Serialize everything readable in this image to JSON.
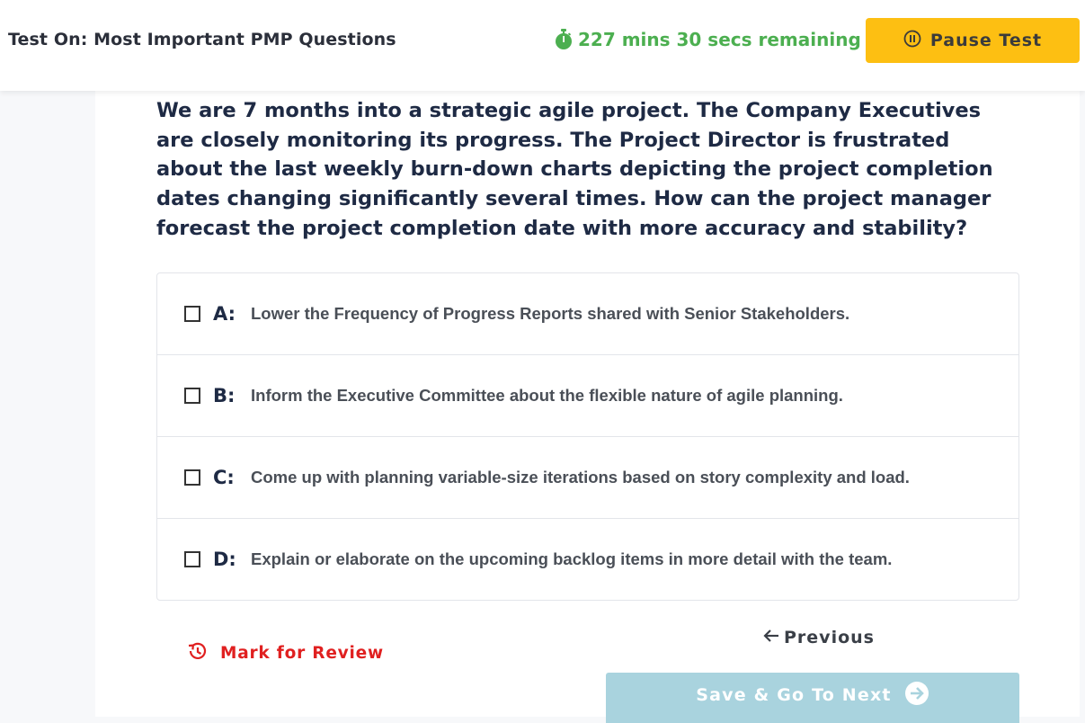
{
  "header": {
    "title": "Test On: Most Important PMP Questions",
    "timer_text": "227 mins 30 secs remaining",
    "timer_icon": "stopwatch-icon",
    "pause_label": "Pause Test",
    "pause_icon": "pause-circle-icon"
  },
  "colors": {
    "timer": "#4caf50",
    "pause_button": "#fdbf12",
    "mark_review": "#e02020",
    "next_button": "#a9d3de",
    "question_text": "#1e2a44"
  },
  "question": {
    "text": "We are 7 months into a strategic agile project. The Company Executives are closely monitoring its progress. The Project Director is frustrated about the last weekly burn-down charts depicting the project completion dates changing significantly several times. How can the project manager forecast the project completion date with more accuracy and stability?"
  },
  "options": [
    {
      "letter": "A:",
      "text": "Lower the Frequency of Progress Reports shared with Senior Stakeholders.",
      "checked": false
    },
    {
      "letter": "B:",
      "text": "Inform the Executive Committee about the flexible nature of agile planning.",
      "checked": false
    },
    {
      "letter": "C:",
      "text": "Come up with planning variable-size iterations based on story complexity and load.",
      "checked": false
    },
    {
      "letter": "D:",
      "text": "Explain or elaborate on the upcoming backlog items in more detail with the team.",
      "checked": false
    }
  ],
  "footer": {
    "mark_review_label": "Mark for Review",
    "mark_review_icon": "history-icon",
    "previous_label": "Previous",
    "previous_icon": "arrow-left-icon",
    "next_label": "Save & Go To Next",
    "next_icon": "arrow-right-circle-icon"
  }
}
